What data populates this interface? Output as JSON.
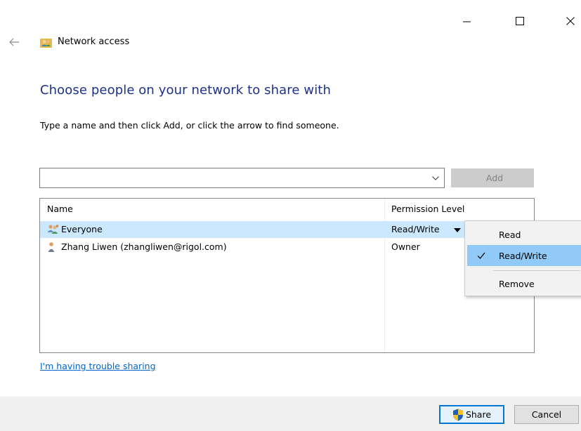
{
  "window_controls": {
    "minimize_icon": "minimize-icon",
    "maximize_icon": "maximize-icon",
    "close_icon": "close-icon"
  },
  "header": {
    "back_icon": "back-arrow-icon",
    "app_icon": "network-people-icon",
    "title": "Network access"
  },
  "main": {
    "heading": "Choose people on your network to share with",
    "instructions": "Type a name and then click Add, or click the arrow to find someone.",
    "name_input": {
      "value": "",
      "placeholder": ""
    },
    "add_button_label": "Add"
  },
  "list": {
    "columns": [
      "Name",
      "Permission Level"
    ],
    "rows": [
      {
        "icon": "group-users-icon",
        "name": "Everyone",
        "permission": "Read/Write",
        "selected": true
      },
      {
        "icon": "user-icon",
        "name": "Zhang Liwen (zhangliwen@rigol.com)",
        "permission": "Owner",
        "selected": false
      }
    ]
  },
  "permission_menu": {
    "items": [
      {
        "label": "Read",
        "checked": false,
        "highlighted": false
      },
      {
        "label": "Read/Write",
        "checked": true,
        "highlighted": true
      },
      {
        "label": "Remove",
        "checked": false,
        "highlighted": false
      }
    ]
  },
  "help_link": "I'm having trouble sharing",
  "footer": {
    "share_label": "Share",
    "cancel_label": "Cancel"
  },
  "colors": {
    "heading": "#1e3287",
    "selected_row": "#cce8ff",
    "menu_highlight": "#91c9f7",
    "link": "#0066cc",
    "primary_button_border": "#0078d7"
  }
}
